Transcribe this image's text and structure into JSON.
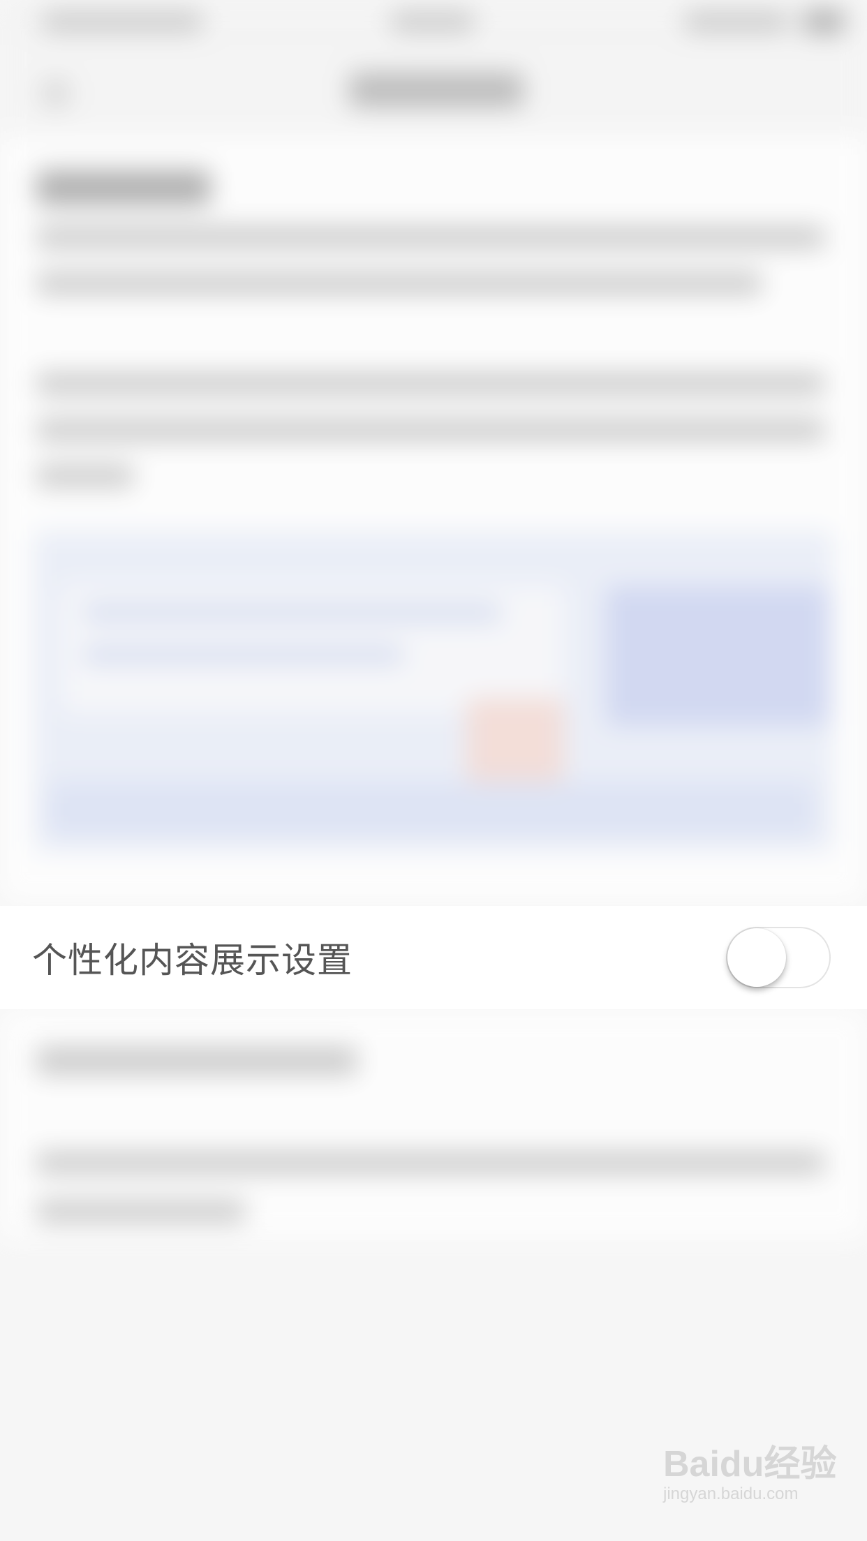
{
  "setting": {
    "label": "个性化内容展示设置",
    "enabled": false
  },
  "watermark": {
    "logo": "Baidu经验",
    "url": "jingyan.baidu.com"
  },
  "colors": {
    "background": "#f6f6f6",
    "row_background": "#ffffff",
    "label_text": "#555555",
    "preview_panel": "#e7ecf8"
  }
}
